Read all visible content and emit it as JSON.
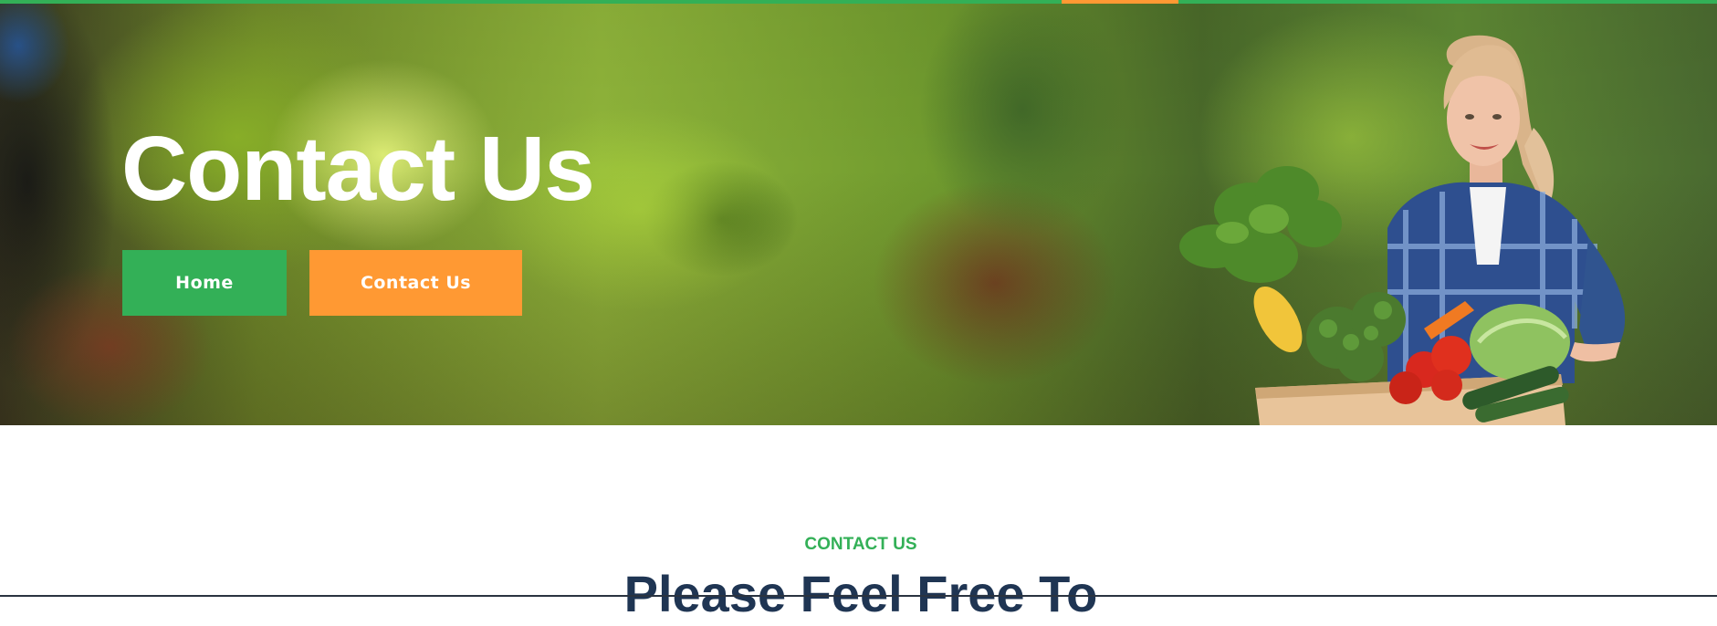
{
  "hero": {
    "title": "Contact Us",
    "breadcrumb": {
      "home_label": "Home",
      "current_label": "Contact Us"
    },
    "illustration": "woman-with-vegetable-basket"
  },
  "section": {
    "label": "CONTACT US",
    "heading": "Please Feel Free To"
  },
  "colors": {
    "brand_green": "#33b057",
    "accent_orange": "#ff9933",
    "heading_navy": "#1f3553"
  }
}
